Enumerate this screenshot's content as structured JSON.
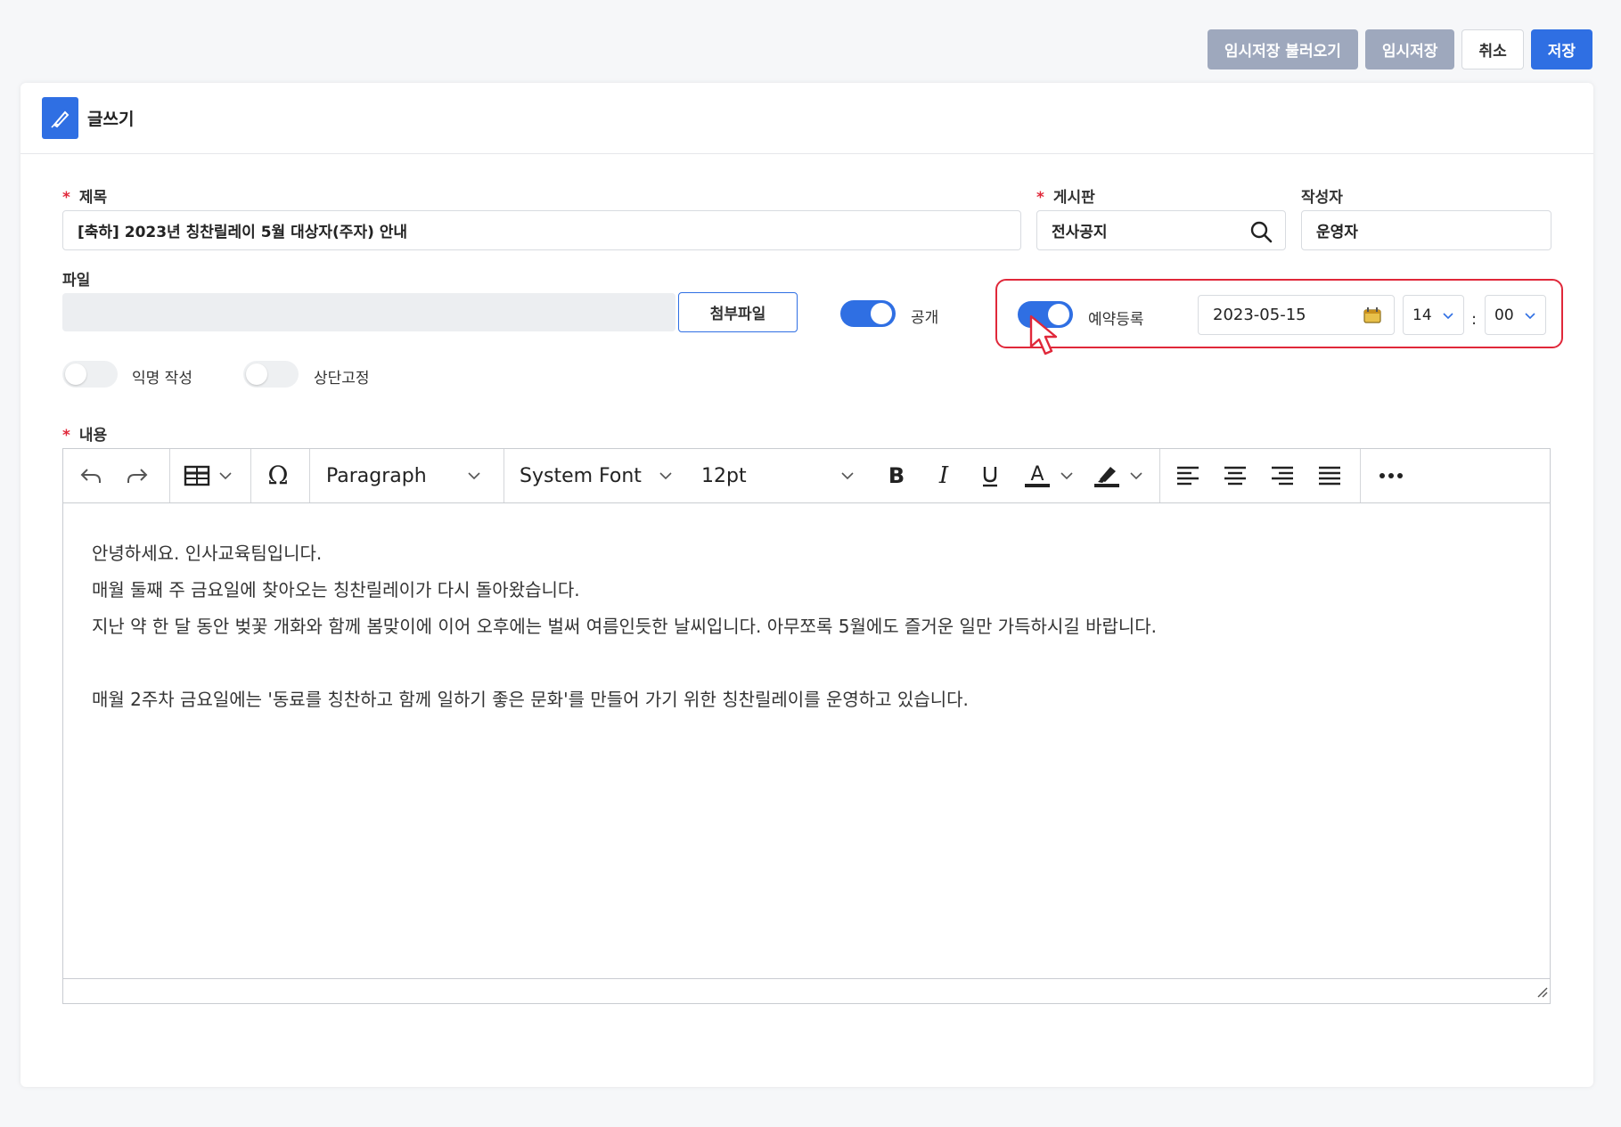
{
  "top_actions": {
    "load_draft": "임시저장 불러오기",
    "save_draft": "임시저장",
    "cancel": "취소",
    "save": "저장"
  },
  "card": {
    "title": "글쓰기"
  },
  "form": {
    "title_label": "제목",
    "title_value": "[축하] 2023년 칭찬릴레이 5월 대상자(주자) 안내",
    "board_label": "게시판",
    "board_value": "전사공지",
    "author_label": "작성자",
    "author_value": "운영자",
    "file_label": "파일",
    "attach_button": "첨부파일",
    "public_label": "공개",
    "public_on": true,
    "reserve_label": "예약등록",
    "reserve_on": true,
    "reserve_date": "2023-05-15",
    "reserve_hour": "14",
    "time_separator": ":",
    "reserve_minute": "00",
    "anonymous_label": "익명 작성",
    "anonymous_on": false,
    "pin_label": "상단고정",
    "pin_on": false,
    "content_label": "내용"
  },
  "editor": {
    "block_format": "Paragraph",
    "font_family": "System Font",
    "font_size": "12pt",
    "content_lines": [
      "안녕하세요. 인사교육팀입니다.",
      "매월 둘째 주 금요일에 찾아오는 칭찬릴레이가 다시 돌아왔습니다.",
      "지난 약 한 달 동안 벚꽃 개화와 함께 봄맞이에 이어 오후에는 벌써 여름인듯한 날씨입니다. 아무쪼록 5월에도 즐거운 일만 가득하시길 바랍니다.",
      "",
      "매월 2주차 금요일에는 '동료를 칭찬하고 함께 일하기 좋은 문화'를 만들어 가기 위한 칭찬릴레이를 운영하고 있습니다."
    ]
  },
  "colors": {
    "accent": "#2f6fe3",
    "required": "#e0283a",
    "highlight": "#e0283a"
  }
}
